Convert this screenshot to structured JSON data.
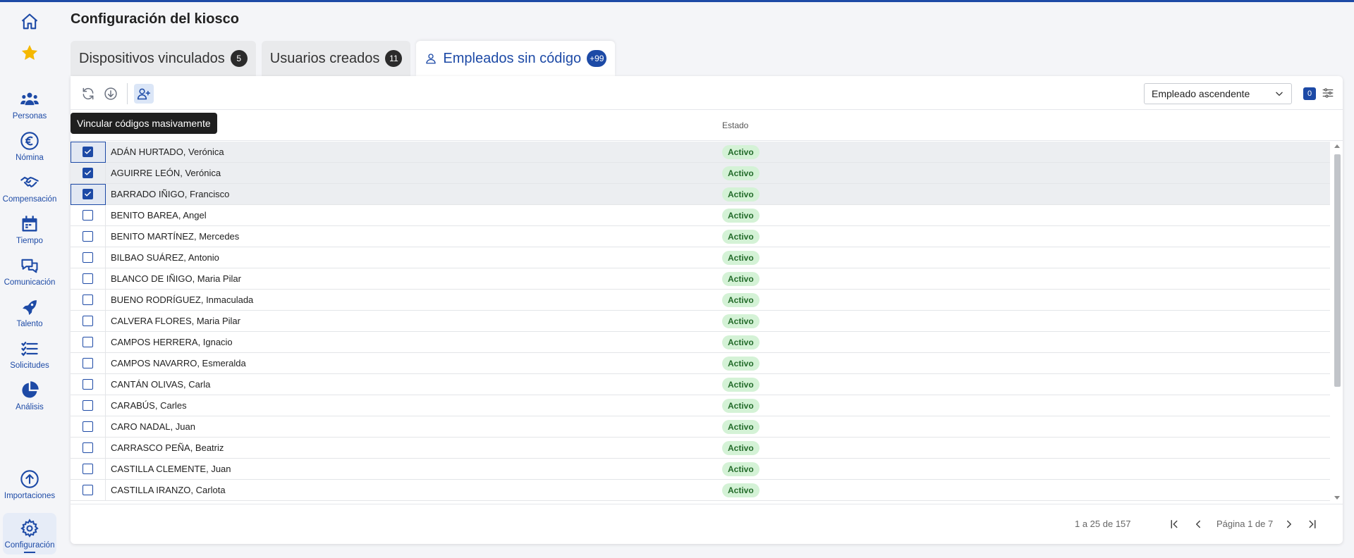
{
  "page": {
    "title": "Configuración del kiosco"
  },
  "sidebar": {
    "items": [
      {
        "label": "Personas",
        "icon": "people-icon"
      },
      {
        "label": "Nómina",
        "icon": "euro-icon"
      },
      {
        "label": "Compensación",
        "icon": "handshake-icon"
      },
      {
        "label": "Tiempo",
        "icon": "calendar-icon"
      },
      {
        "label": "Comunicación",
        "icon": "chat-icon"
      },
      {
        "label": "Talento",
        "icon": "rocket-icon"
      },
      {
        "label": "Solicitudes",
        "icon": "checklist-icon"
      },
      {
        "label": "Análisis",
        "icon": "pie-chart-icon"
      }
    ],
    "bottom": [
      {
        "label": "Importaciones",
        "icon": "upload-icon"
      },
      {
        "label": "Configuración",
        "icon": "gear-icon"
      }
    ],
    "colors": {
      "accent": "#1d4aa6",
      "star": "#f5b800"
    }
  },
  "tabs": [
    {
      "label": "Dispositivos vinculados",
      "count": "5"
    },
    {
      "label": "Usuarios creados",
      "count": "11"
    },
    {
      "label": "Empleados sin código",
      "count": "+99"
    }
  ],
  "toolbar": {
    "tooltip": "Vincular códigos masivamente",
    "sort_value": "Empleado ascendente",
    "filter_count": "0"
  },
  "table": {
    "columns": {
      "estado": "Estado"
    },
    "rows": [
      {
        "name": "ADÁN HURTADO, Verónica",
        "status": "Activo",
        "checked": true
      },
      {
        "name": "AGUIRRE LEÓN, Verónica",
        "status": "Activo",
        "checked": true
      },
      {
        "name": "BARRADO IÑIGO, Francisco",
        "status": "Activo",
        "checked": true
      },
      {
        "name": "BENITO BAREA, Angel",
        "status": "Activo",
        "checked": false
      },
      {
        "name": "BENITO MARTÍNEZ, Mercedes",
        "status": "Activo",
        "checked": false
      },
      {
        "name": "BILBAO SUÁREZ, Antonio",
        "status": "Activo",
        "checked": false
      },
      {
        "name": "BLANCO DE IÑIGO, Maria Pilar",
        "status": "Activo",
        "checked": false
      },
      {
        "name": "BUENO RODRÍGUEZ, Inmaculada",
        "status": "Activo",
        "checked": false
      },
      {
        "name": "CALVERA FLORES, Maria Pilar",
        "status": "Activo",
        "checked": false
      },
      {
        "name": "CAMPOS HERRERA, Ignacio",
        "status": "Activo",
        "checked": false
      },
      {
        "name": "CAMPOS NAVARRO, Esmeralda",
        "status": "Activo",
        "checked": false
      },
      {
        "name": "CANTÁN OLIVAS, Carla",
        "status": "Activo",
        "checked": false
      },
      {
        "name": "CARABÚS, Carles",
        "status": "Activo",
        "checked": false
      },
      {
        "name": "CARO NADAL, Juan",
        "status": "Activo",
        "checked": false
      },
      {
        "name": "CARRASCO PEÑA, Beatriz",
        "status": "Activo",
        "checked": false
      },
      {
        "name": "CASTILLA CLEMENTE, Juan",
        "status": "Activo",
        "checked": false
      },
      {
        "name": "CASTILLA IRANZO, Carlota",
        "status": "Activo",
        "checked": false
      }
    ]
  },
  "pagination": {
    "range": "1 a 25 de 157",
    "label": "Página 1 de 7"
  }
}
